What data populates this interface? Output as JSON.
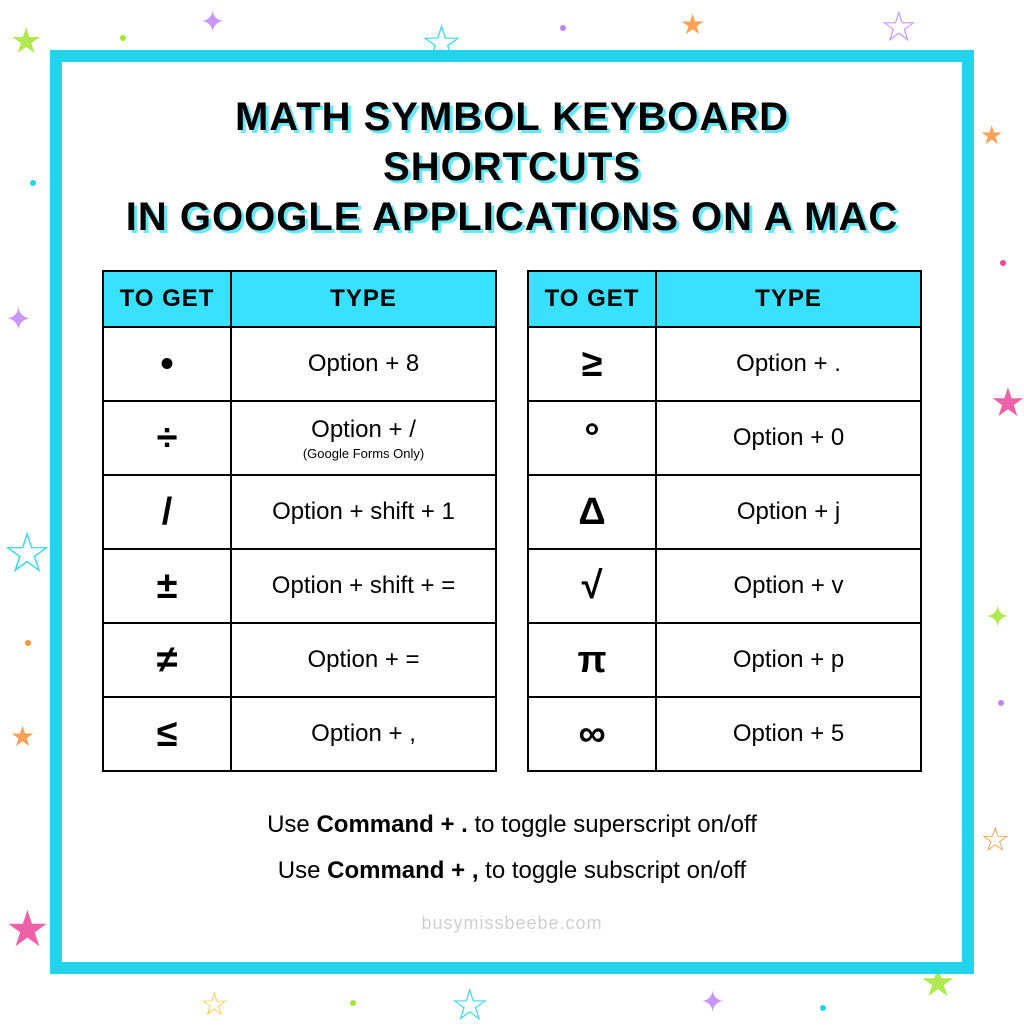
{
  "title_line1": "MATH SYMBOL KEYBOARD SHORTCUTS",
  "title_line2": "IN GOOGLE APPLICATIONS ON A MAC",
  "headers": {
    "to_get": "TO GET",
    "type": "TYPE"
  },
  "left_rows": [
    {
      "sym": "•",
      "type": "Option + 8",
      "note": ""
    },
    {
      "sym": "÷",
      "type": "Option + /",
      "note": "(Google Forms Only)"
    },
    {
      "sym": "/",
      "type": "Option + shift + 1",
      "note": ""
    },
    {
      "sym": "±",
      "type": "Option + shift + =",
      "note": ""
    },
    {
      "sym": "≠",
      "type": "Option + =",
      "note": ""
    },
    {
      "sym": "≤",
      "type": "Option + ,",
      "note": ""
    }
  ],
  "right_rows": [
    {
      "sym": "≥",
      "type": "Option + .",
      "note": ""
    },
    {
      "sym": "°",
      "type": "Option + 0",
      "note": ""
    },
    {
      "sym": "Δ",
      "type": "Option + j",
      "note": ""
    },
    {
      "sym": "√",
      "type": "Option + v",
      "note": ""
    },
    {
      "sym": "π",
      "type": "Option + p",
      "note": ""
    },
    {
      "sym": "∞",
      "type": "Option + 5",
      "note": ""
    }
  ],
  "tip1_pre": "Use ",
  "tip1_bold": "Command + .",
  "tip1_post": " to toggle superscript on/off",
  "tip2_pre": "Use ",
  "tip2_bold": "Command + ,",
  "tip2_post": " to toggle subscript on/off",
  "footer": "busymissbeebe.com"
}
